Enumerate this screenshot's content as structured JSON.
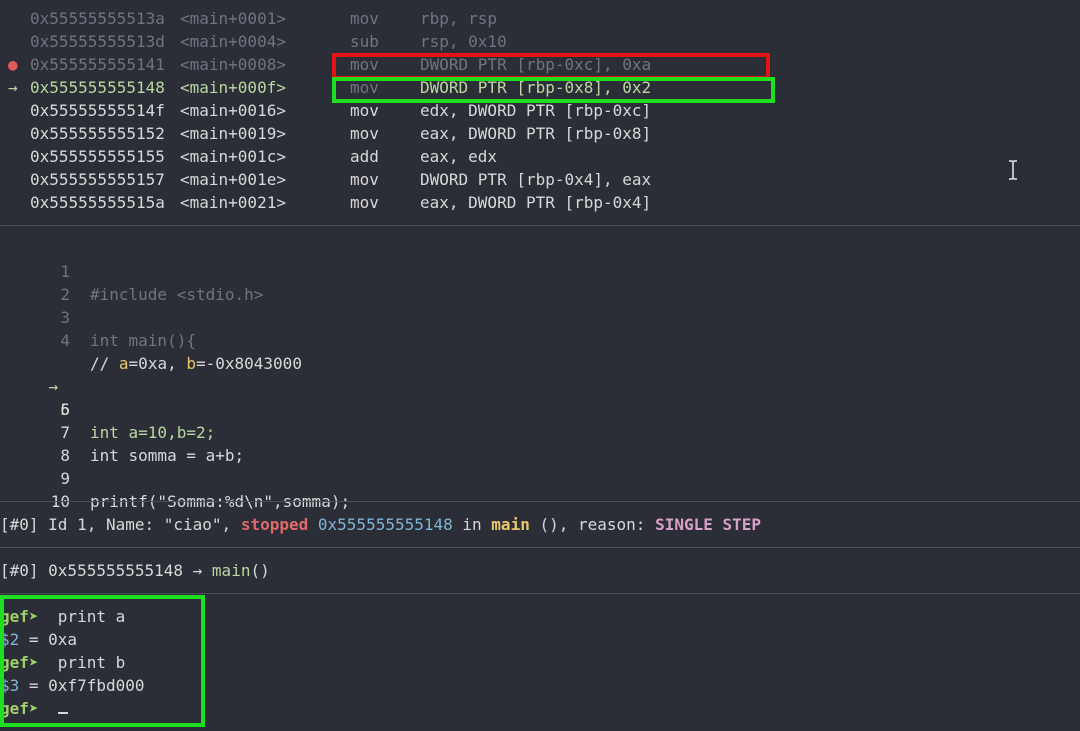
{
  "disasm": [
    {
      "marker": "",
      "addr": "0x55555555513a",
      "sym": "<main+0001>",
      "op": "mov",
      "args": "rbp, rsp",
      "state": "past"
    },
    {
      "marker": "",
      "addr": "0x55555555513d",
      "sym": "<main+0004>",
      "op": "sub",
      "args": "rsp, 0x10",
      "state": "past"
    },
    {
      "marker": "●",
      "addr": "0x555555555141",
      "sym": "<main+0008>",
      "op": "mov",
      "args": "DWORD PTR [rbp-0xc], 0xa",
      "state": "past"
    },
    {
      "marker": "→",
      "addr": "0x555555555148",
      "sym": "<main+000f>",
      "op": "mov",
      "args": "DWORD PTR [rbp-0x8], 0x2",
      "state": "current"
    },
    {
      "marker": "",
      "addr": "0x55555555514f",
      "sym": "<main+0016>",
      "op": "mov",
      "args": "edx, DWORD PTR [rbp-0xc]",
      "state": "next"
    },
    {
      "marker": "",
      "addr": "0x555555555152",
      "sym": "<main+0019>",
      "op": "mov",
      "args": "eax, DWORD PTR [rbp-0x8]",
      "state": "next"
    },
    {
      "marker": "",
      "addr": "0x555555555155",
      "sym": "<main+001c>",
      "op": "add",
      "args": "eax, edx",
      "state": "next"
    },
    {
      "marker": "",
      "addr": "0x555555555157",
      "sym": "<main+001e>",
      "op": "mov",
      "args": "DWORD PTR [rbp-0x4], eax",
      "state": "next"
    },
    {
      "marker": "",
      "addr": "0x55555555515a",
      "sym": "<main+0021>",
      "op": "mov",
      "args": "eax, DWORD PTR [rbp-0x4]",
      "state": "next"
    }
  ],
  "source": {
    "l1": {
      "num": "1",
      "text": "#include <stdio.h>"
    },
    "l2": {
      "num": "2",
      "text": ""
    },
    "l3": {
      "num": "3",
      "text": "int main(){"
    },
    "l4": {
      "num": "4",
      "text": ""
    },
    "comment": {
      "a_name": "a",
      "a_val": "=0xa, ",
      "b_name": "b",
      "b_val": "=-0x8043000",
      "prefix": "// "
    },
    "l5": {
      "marker": "→",
      "num": "5",
      "text": "int a=10,b=2;"
    },
    "l6": {
      "num": "6",
      "text": ""
    },
    "l7": {
      "num": "7",
      "text": "int somma = a+b;"
    },
    "l8": {
      "num": "8",
      "text": ""
    },
    "l9": {
      "num": "9",
      "text": "printf(\"Somma:%d\\n\",somma);"
    },
    "l10": {
      "num": "10",
      "text": ""
    }
  },
  "threads": {
    "idx": "[#0]",
    "pre": " Id 1, Name: \"ciao\", ",
    "stopped": "stopped",
    "addr": " 0x555555555148",
    "in": " in ",
    "fn": "main",
    "mid": " (), reason: ",
    "reason": "SINGLE STEP"
  },
  "trace": {
    "idx": "[#0]",
    "addr": " 0x555555555148 → ",
    "fn": "main",
    "tail": "()"
  },
  "console": {
    "prompt": "gef➤",
    "cmd1": "  print a",
    "res1_var": "$2",
    "res1_val": " = 0xa",
    "cmd2": "  print b",
    "res2_var": "$3",
    "res2_val": " = 0xf7fbd000",
    "cmd3": "  "
  },
  "colors": {
    "background": "#2b2e36",
    "highlight_red": "#e21414",
    "highlight_green": "#1fe01f"
  },
  "icons": {
    "mouse_cursor": "text-ibeam-icon"
  }
}
